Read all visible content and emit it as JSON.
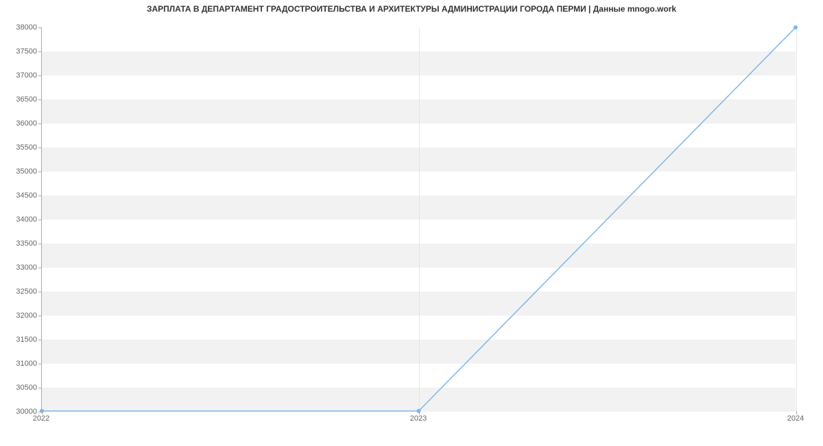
{
  "chart_data": {
    "type": "line",
    "title": "ЗАРПЛАТА В ДЕПАРТАМЕНТ ГРАДОСТРОИТЕЛЬСТВА И АРХИТЕКТУРЫ АДМИНИСТРАЦИИ ГОРОДА ПЕРМИ | Данные mnogo.work",
    "x": [
      2022,
      2023,
      2024
    ],
    "values": [
      30000,
      30000,
      38000
    ],
    "xlabel": "",
    "ylabel": "",
    "xlim": [
      2022,
      2024
    ],
    "ylim": [
      30000,
      38000
    ],
    "y_ticks": [
      30000,
      30500,
      31000,
      31500,
      32000,
      32500,
      33000,
      33500,
      34000,
      34500,
      35000,
      35500,
      36000,
      36500,
      37000,
      37500,
      38000
    ],
    "x_ticks": [
      2022,
      2023,
      2024
    ],
    "band_color": "#f2f2f2",
    "line_color": "#7cb5ec"
  }
}
